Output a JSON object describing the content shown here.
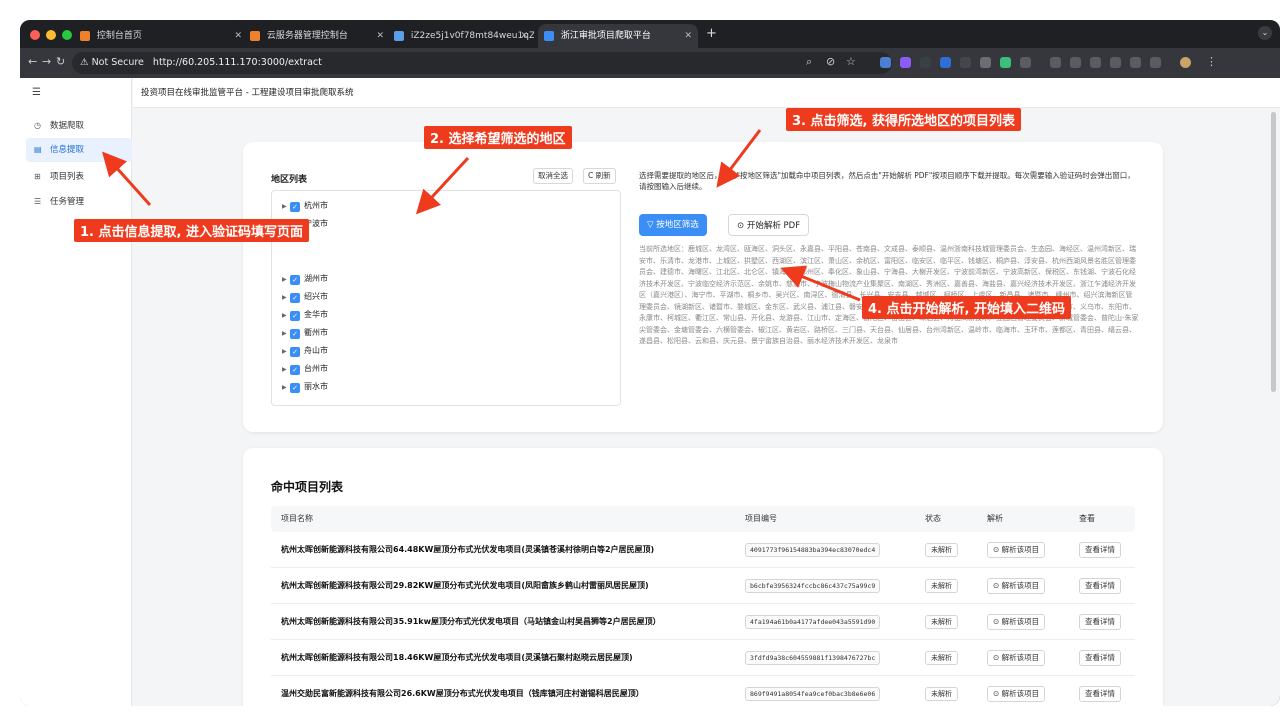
{
  "browser": {
    "tabs": [
      {
        "title": "控制台首页",
        "icon_color": "#f0802a"
      },
      {
        "title": "云服务器管理控制台",
        "icon_color": "#f0802a"
      },
      {
        "title": "iZ2ze5j1v0f78mt84weu1qZ -",
        "icon_color": "#5aa0e8"
      },
      {
        "title": "浙江审批项目爬取平台",
        "icon_color": "#3a8ef6",
        "active": true
      }
    ],
    "new_tab": "+",
    "not_secure": "Not Secure",
    "url": "http://60.205.111.170:3000/extract"
  },
  "sidebar": {
    "items": [
      {
        "icon": "◷",
        "label": "数据爬取"
      },
      {
        "icon": "▤",
        "label": "信息提取",
        "active": true
      },
      {
        "icon": "⊞",
        "label": "项目列表"
      },
      {
        "icon": "☰",
        "label": "任务管理"
      }
    ]
  },
  "header": {
    "breadcrumb": "投资项目在线审批监管平台 - 工程建设项目审批爬取系统"
  },
  "region_panel": {
    "title": "地区列表",
    "deselect_all": "取消全选",
    "refresh": "C 刷新",
    "cities": [
      "杭州市",
      "宁波市",
      "湖州市",
      "绍兴市",
      "金华市",
      "衢州市",
      "舟山市",
      "台州市",
      "丽水市"
    ]
  },
  "instructions": "选择需要提取的地区后，点击\"按地区筛选\"加载命中项目列表，然后点击\"开始解析 PDF\"按项目顺序下载并提取。每次需要输入验证码时会弹出窗口，请按图输入后继续。",
  "filter_button": "按地区筛选",
  "parse_button": "开始解析 PDF",
  "selected_regions_text": "当前所选地区：鹿城区、龙湾区、瓯海区、洞头区、永嘉县、平阳县、苍南县、文成县、泰顺县、温州浙南科技城管理委员会、生态园、海经区、温州湾新区、瑞安市、乐清市、龙港市、上城区、拱墅区、西湖区、滨江区、萧山区、余杭区、富阳区、临安区、临平区、钱塘区、桐庐县、淳安县、杭州西湖风景名胜区管理委员会、建德市、海曙区、江北区、北仑区、镇海区、鄞州区、奉化区、象山县、宁海县、大榭开发区、宁波前湾新区、宁波高新区、保税区、东钱湖、宁波石化经济技术开发区、宁波临空经济示范区、余姚市、慈溪市、宁波梅山物流产业集聚区、南湖区、秀洲区、嘉善县、海盐县、嘉兴经济技术开发区、浙江乍浦经济开发区（嘉兴港区）、海宁市、平湖市、桐乡市、吴兴区、南浔区、德清县、长兴县、安吉县、越城区、柯桥区、上虞区、新昌县、诸暨市、嵊州市、绍兴滨海新区管理委员会、镜湖新区、诸暨市、婺城区、金东区、武义县、浦江县、磐安县、兰溪市、义乌市、东阳市、永康市、华数龙风景旅游区、兰溪市、义乌市、东阳市、永康市、柯城区、衢江区、常山县、开化县、龙游县、江山市、定海区、普陀区、岱山县、嵊泗县、舟山高新技术产业园区管理委员会、新城管委会、普陀山-朱家尖管委会、金塘管委会、六横管委会、椒江区、黄岩区、路桥区、三门县、天台县、仙居县、台州湾新区、温岭市、临海市、玉环市、莲都区、青田县、缙云县、遂昌县、松阳县、云和县、庆元县、景宁畲族自治县、丽水经济技术开发区、龙泉市",
  "project_list": {
    "title": "命中项目列表",
    "headers": [
      "项目名称",
      "项目编号",
      "状态",
      "解析",
      "查看"
    ],
    "rows": [
      {
        "name": "杭州太晖创新能源科技有限公司64.48KW屋顶分布式光伏发电项目(灵溪镇苍溪村徐明白等2户居民屋顶)",
        "code": "4091773f96154883ba394ec83070edc4",
        "status": "未解析",
        "parse": "解析该项目",
        "view": "查看详情"
      },
      {
        "name": "杭州太晖创新能源科技有限公司29.82KW屋顶分布式光伏发电项目(凤阳畲族乡鹤山村雷丽凤居民屋顶)",
        "code": "b6cbfe3956324fccbc86c437c75a99c9",
        "status": "未解析",
        "parse": "解析该项目",
        "view": "查看详情"
      },
      {
        "name": "杭州太晖创新能源科技有限公司35.91kw屋顶分布式光伏发电项目（马站镇金山村吴昌狮等2户居民屋顶）",
        "code": "4fa194a61b0a4177afdee043a5591d90",
        "status": "未解析",
        "parse": "解析该项目",
        "view": "查看详情"
      },
      {
        "name": "杭州太晖创新能源科技有限公司18.46KW屋顶分布式光伏发电项目(灵溪镇石聚村赵晓云居民屋顶)",
        "code": "3fdfd9a38c604559881f1398476727bc",
        "status": "未解析",
        "parse": "解析该项目",
        "view": "查看详情"
      },
      {
        "name": "温州交勋民富新能源科技有限公司26.6KW屋顶分布式光伏发电项目（钱库镇河庄村谢锡科居民屋顶）",
        "code": "869f9491a8054fea9cef0bac3b8e6e06",
        "status": "未解析",
        "parse": "解析该项目",
        "view": "查看详情"
      }
    ]
  },
  "annotations": {
    "step1": "1. 点击信息提取, 进入验证码填写页面",
    "step2": "2. 选择希望筛选的地区",
    "step3": "3. 点击筛选, 获得所选地区的项目列表",
    "step4": "4. 点击开始解析, 开始填入二维码",
    "color": "#ee3b1e"
  }
}
